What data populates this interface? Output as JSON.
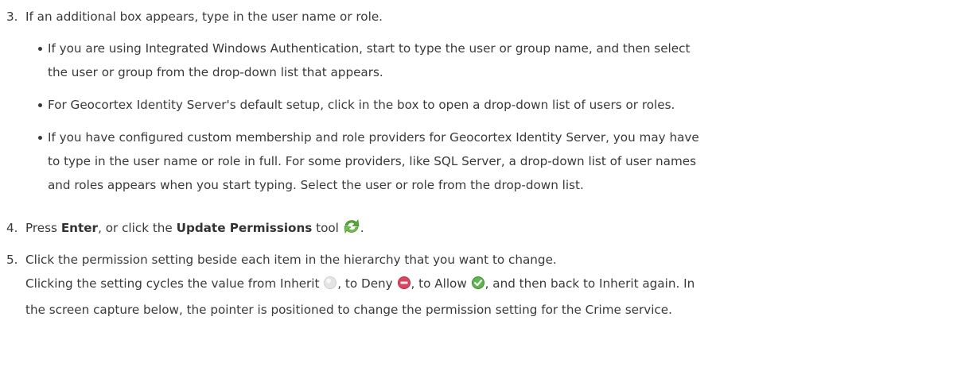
{
  "step3": {
    "number": "3.",
    "text": "If an additional box appears, type in the user name or role.",
    "bullets": [
      {
        "line1": "If you are using Integrated Windows Authentication, start to type the user or group name, and then select",
        "line2": "the user or group from the drop-down list that appears."
      },
      {
        "line1": "For Geocortex Identity Server's default setup, click in the box to open a drop-down list of users or roles."
      },
      {
        "line1": "If you have configured custom membership and role providers for Geocortex Identity Server, you may have",
        "line2": "to type in the user name or role in full. For some providers, like SQL Server, a drop-down list of user names",
        "line3": "and roles appears when you start typing. Select the user or role from the drop-down list."
      }
    ]
  },
  "step4": {
    "number": "4.",
    "press": "Press ",
    "key": "Enter",
    "mid": ", or click the ",
    "tool_name": "Update Permissions",
    "tool_word": " tool",
    "end": ".",
    "icon": "refresh-arrows-icon"
  },
  "step5": {
    "number": "5.",
    "text": "Click the permission setting beside each item in the hierarchy that you want to change.",
    "detail_a": "Clicking the setting cycles the value from Inherit ",
    "detail_b": ", to Deny ",
    "detail_c": ", to Allow ",
    "detail_d": ", and then back to Inherit again. In",
    "detail_line2": "the screen capture below, the pointer is positioned to change the permission setting for the Crime service.",
    "icons": {
      "inherit": "inherit-grey-circle-icon",
      "deny": "deny-red-minus-icon",
      "allow": "allow-green-check-icon"
    }
  },
  "colors": {
    "text": "#3a3a3a",
    "deny": "#e2435a",
    "allow": "#5cb84a",
    "inherit": "#d6d6d6",
    "refresh": "#4caf2a"
  }
}
